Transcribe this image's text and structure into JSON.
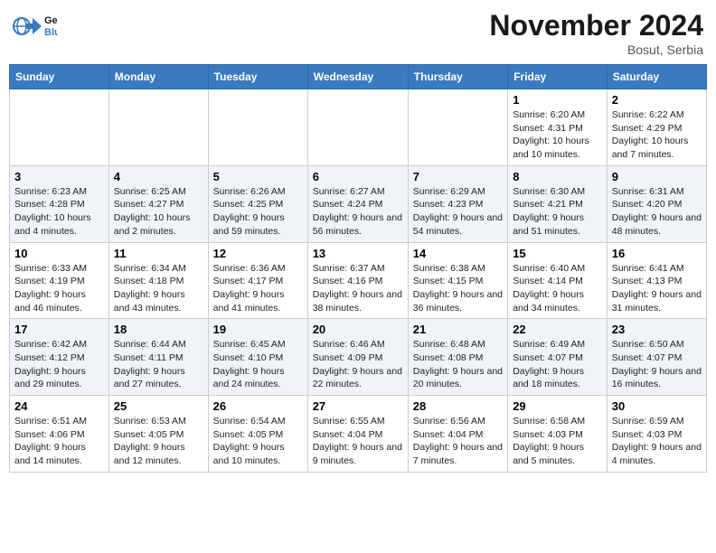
{
  "header": {
    "logo_line1": "General",
    "logo_line2": "Blue",
    "month_title": "November 2024",
    "location": "Bosut, Serbia"
  },
  "weekdays": [
    "Sunday",
    "Monday",
    "Tuesday",
    "Wednesday",
    "Thursday",
    "Friday",
    "Saturday"
  ],
  "rows": [
    [
      {
        "num": "",
        "info": ""
      },
      {
        "num": "",
        "info": ""
      },
      {
        "num": "",
        "info": ""
      },
      {
        "num": "",
        "info": ""
      },
      {
        "num": "",
        "info": ""
      },
      {
        "num": "1",
        "info": "Sunrise: 6:20 AM\nSunset: 4:31 PM\nDaylight: 10 hours and 10 minutes."
      },
      {
        "num": "2",
        "info": "Sunrise: 6:22 AM\nSunset: 4:29 PM\nDaylight: 10 hours and 7 minutes."
      }
    ],
    [
      {
        "num": "3",
        "info": "Sunrise: 6:23 AM\nSunset: 4:28 PM\nDaylight: 10 hours and 4 minutes."
      },
      {
        "num": "4",
        "info": "Sunrise: 6:25 AM\nSunset: 4:27 PM\nDaylight: 10 hours and 2 minutes."
      },
      {
        "num": "5",
        "info": "Sunrise: 6:26 AM\nSunset: 4:25 PM\nDaylight: 9 hours and 59 minutes."
      },
      {
        "num": "6",
        "info": "Sunrise: 6:27 AM\nSunset: 4:24 PM\nDaylight: 9 hours and 56 minutes."
      },
      {
        "num": "7",
        "info": "Sunrise: 6:29 AM\nSunset: 4:23 PM\nDaylight: 9 hours and 54 minutes."
      },
      {
        "num": "8",
        "info": "Sunrise: 6:30 AM\nSunset: 4:21 PM\nDaylight: 9 hours and 51 minutes."
      },
      {
        "num": "9",
        "info": "Sunrise: 6:31 AM\nSunset: 4:20 PM\nDaylight: 9 hours and 48 minutes."
      }
    ],
    [
      {
        "num": "10",
        "info": "Sunrise: 6:33 AM\nSunset: 4:19 PM\nDaylight: 9 hours and 46 minutes."
      },
      {
        "num": "11",
        "info": "Sunrise: 6:34 AM\nSunset: 4:18 PM\nDaylight: 9 hours and 43 minutes."
      },
      {
        "num": "12",
        "info": "Sunrise: 6:36 AM\nSunset: 4:17 PM\nDaylight: 9 hours and 41 minutes."
      },
      {
        "num": "13",
        "info": "Sunrise: 6:37 AM\nSunset: 4:16 PM\nDaylight: 9 hours and 38 minutes."
      },
      {
        "num": "14",
        "info": "Sunrise: 6:38 AM\nSunset: 4:15 PM\nDaylight: 9 hours and 36 minutes."
      },
      {
        "num": "15",
        "info": "Sunrise: 6:40 AM\nSunset: 4:14 PM\nDaylight: 9 hours and 34 minutes."
      },
      {
        "num": "16",
        "info": "Sunrise: 6:41 AM\nSunset: 4:13 PM\nDaylight: 9 hours and 31 minutes."
      }
    ],
    [
      {
        "num": "17",
        "info": "Sunrise: 6:42 AM\nSunset: 4:12 PM\nDaylight: 9 hours and 29 minutes."
      },
      {
        "num": "18",
        "info": "Sunrise: 6:44 AM\nSunset: 4:11 PM\nDaylight: 9 hours and 27 minutes."
      },
      {
        "num": "19",
        "info": "Sunrise: 6:45 AM\nSunset: 4:10 PM\nDaylight: 9 hours and 24 minutes."
      },
      {
        "num": "20",
        "info": "Sunrise: 6:46 AM\nSunset: 4:09 PM\nDaylight: 9 hours and 22 minutes."
      },
      {
        "num": "21",
        "info": "Sunrise: 6:48 AM\nSunset: 4:08 PM\nDaylight: 9 hours and 20 minutes."
      },
      {
        "num": "22",
        "info": "Sunrise: 6:49 AM\nSunset: 4:07 PM\nDaylight: 9 hours and 18 minutes."
      },
      {
        "num": "23",
        "info": "Sunrise: 6:50 AM\nSunset: 4:07 PM\nDaylight: 9 hours and 16 minutes."
      }
    ],
    [
      {
        "num": "24",
        "info": "Sunrise: 6:51 AM\nSunset: 4:06 PM\nDaylight: 9 hours and 14 minutes."
      },
      {
        "num": "25",
        "info": "Sunrise: 6:53 AM\nSunset: 4:05 PM\nDaylight: 9 hours and 12 minutes."
      },
      {
        "num": "26",
        "info": "Sunrise: 6:54 AM\nSunset: 4:05 PM\nDaylight: 9 hours and 10 minutes."
      },
      {
        "num": "27",
        "info": "Sunrise: 6:55 AM\nSunset: 4:04 PM\nDaylight: 9 hours and 9 minutes."
      },
      {
        "num": "28",
        "info": "Sunrise: 6:56 AM\nSunset: 4:04 PM\nDaylight: 9 hours and 7 minutes."
      },
      {
        "num": "29",
        "info": "Sunrise: 6:58 AM\nSunset: 4:03 PM\nDaylight: 9 hours and 5 minutes."
      },
      {
        "num": "30",
        "info": "Sunrise: 6:59 AM\nSunset: 4:03 PM\nDaylight: 9 hours and 4 minutes."
      }
    ]
  ]
}
